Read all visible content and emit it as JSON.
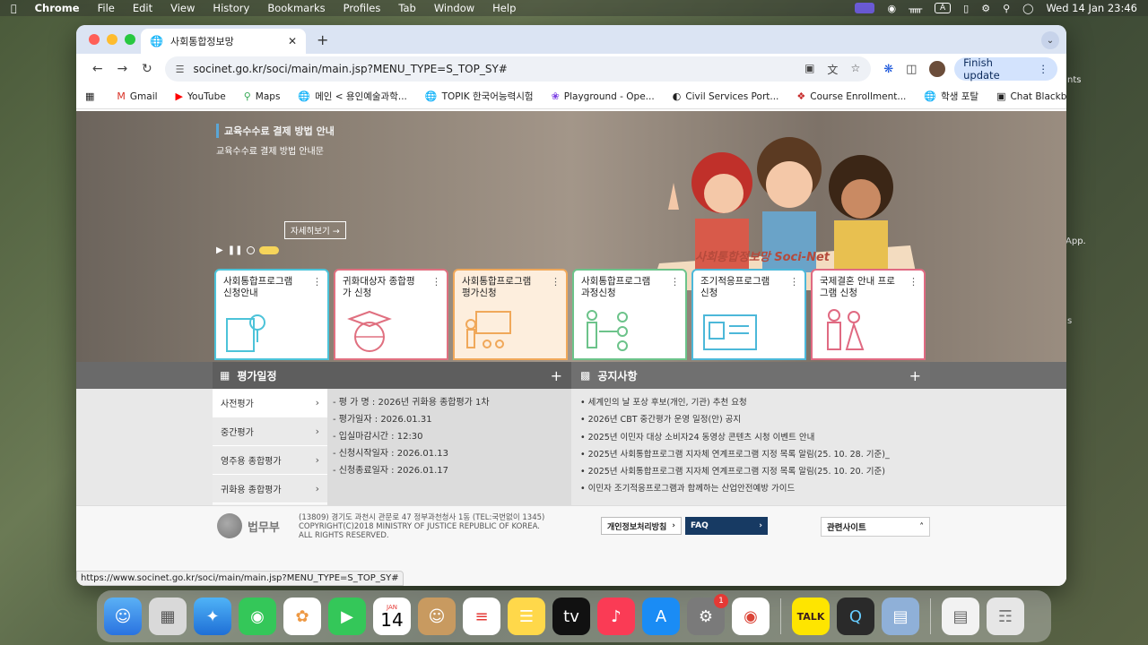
{
  "menubar": {
    "apple": "",
    "app": "Chrome",
    "menus": [
      "File",
      "Edit",
      "View",
      "History",
      "Bookmarks",
      "Profiles",
      "Tab",
      "Window",
      "Help"
    ],
    "datetime": "Wed 14 Jan  23:46"
  },
  "desktop": {
    "side_texts": [
      "nts",
      "App.",
      "s"
    ]
  },
  "browser": {
    "tab_title": "사회통합정보망",
    "url": "socinet.go.kr/soci/main/main.jsp?MENU_TYPE=S_TOP_SY#",
    "finish_update": "Finish update",
    "bookmarks": [
      "Gmail",
      "YouTube",
      "Maps",
      "메인 < 용인예술과학...",
      "TOPIK 한국어능력시험",
      "Playground - Ope...",
      "Civil Services Port...",
      "Course Enrollment...",
      "학생 포탈",
      "Chat Blackbox: AI..."
    ],
    "status_url": "https://www.socinet.go.kr/soci/main/main.jsp?MENU_TYPE=S_TOP_SY#"
  },
  "hero": {
    "title": "교육수수료 결제 방법 안내",
    "subtitle": "교육수수료  결제  방법  안내문",
    "more_button": "자세히보기",
    "logo_text": "사회통합정보망 Soci-Net"
  },
  "cards": [
    {
      "label": "사회통합프로그램 신청안내",
      "color": "#4cc3d9"
    },
    {
      "label": "귀화대상자 종합평가 신청",
      "color": "#e07080"
    },
    {
      "label": "사회통합프로그램 평가신청",
      "color": "#f0a85a"
    },
    {
      "label": "사회통합프로그램 과정신청",
      "color": "#6cc38a"
    },
    {
      "label": "조기적응프로그램 신청",
      "color": "#4cb8d9"
    },
    {
      "label": "국제결혼 안내 프로그램 신청",
      "color": "#e06a82"
    }
  ],
  "schedule": {
    "title": "평가일정",
    "tabs": [
      "사전평가",
      "중간평가",
      "영주용 종합평가",
      "귀화용 종합평가"
    ],
    "details": [
      "- 평 가 명 : 2026년 귀화용 종합평가 1차",
      "- 평가일자 : 2026.01.31",
      "- 입실마감시간 : 12:30",
      "- 신청시작일자 : 2026.01.13",
      "- 신청종료일자 : 2026.01.17"
    ]
  },
  "notices": {
    "title": "공지사항",
    "items": [
      "세계인의 날 포상 후보(개인, 기관) 추천 요청",
      "2026년 CBT 중간평가 운영 일정(안) 공지",
      "2025년 이민자 대상 소비자24 동영상 콘텐츠 시청 이벤트 안내",
      "2025년 사회통합프로그램 지자체 연계프로그램 지정 목록 알림(25. 10. 28. 기준)_",
      "2025년 사회통합프로그램 지자체 연계프로그램 지정 목록 알림(25. 10. 20. 기준)",
      "이민자 조기적응프로그램과 함께하는 산업안전예방 가이드"
    ]
  },
  "footer": {
    "ministry": "법무부",
    "address_line1": "(13809) 경기도 과천시 관문로 47 정부과천청사 1동 (TEL:국번없이 1345)",
    "address_line2": "COPYRIGHT(C)2018 MINISTRY OF JUSTICE REPUBLIC OF KOREA.",
    "address_line3": "ALL RIGHTS RESERVED.",
    "privacy": "개인정보처리방침",
    "faq": "FAQ",
    "related": "관련사이트"
  },
  "dock": {
    "calendar_month": "JAN",
    "calendar_day": "14",
    "settings_badge": "1",
    "apps": [
      "finder-icon",
      "launchpad-icon",
      "safari-icon",
      "messages-icon",
      "photos-icon",
      "facetime-icon",
      "calendar-icon",
      "contacts-icon",
      "reminders-icon",
      "notes-icon",
      "appletv-icon",
      "music-icon",
      "appstore-icon",
      "settings-icon",
      "chrome-icon",
      "kakaotalk-icon",
      "quicktime-icon",
      "preview-icon",
      "document-icon",
      "trash-icon"
    ]
  }
}
